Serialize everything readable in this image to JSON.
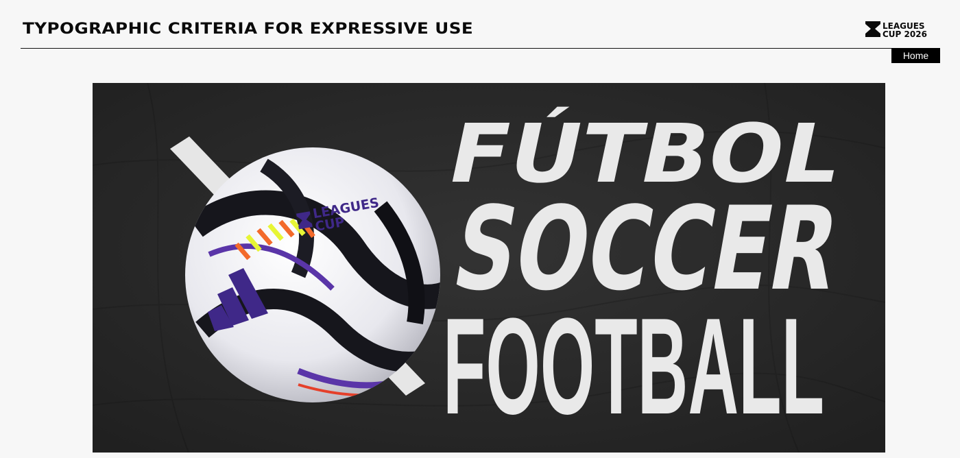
{
  "header": {
    "title": "TYPOGRAPHIC CRITERIA FOR EXPRESSIVE USE",
    "brand_logo": {
      "icon": "hourglass-logo-icon",
      "line1": "LEAGUES",
      "line2": "CUP 2026"
    },
    "nav": {
      "home_label": "Home"
    }
  },
  "hero": {
    "lines": [
      "FÚTBOL",
      "SOCCER",
      "FOOTBALL"
    ],
    "ball_logo": {
      "line1": "LEAGUES",
      "line2": "CUP"
    }
  },
  "colors": {
    "page_background": "#f7f7f7",
    "text": "#0a0a0a",
    "nav_background": "#000000",
    "nav_text": "#ffffff",
    "hero_background": "#2b2b2b",
    "hero_text": "#e9e9e9",
    "ball_accent": "#4b2a8e"
  }
}
